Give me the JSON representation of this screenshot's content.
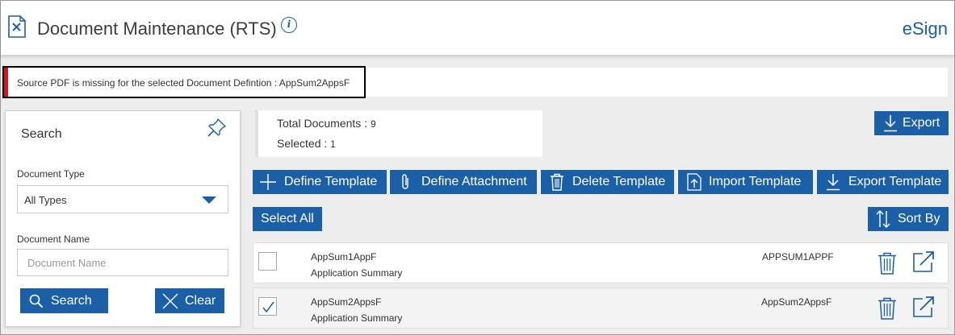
{
  "header": {
    "title": "Document Maintenance (RTS)",
    "brand": "eSign",
    "icons": {
      "doc": "document-tools-icon",
      "info": "info-icon"
    },
    "info_glyph": "i"
  },
  "alert": {
    "message": "Source PDF is missing for the selected Document Defintion : AppSum2AppsF",
    "color": "#d9121b"
  },
  "search": {
    "title": "Search",
    "document_type_label": "Document Type",
    "document_type_value": "All Types",
    "document_name_label": "Document Name",
    "document_name_placeholder": "Document Name",
    "search_button": "Search",
    "clear_button": "Clear"
  },
  "summary": {
    "total_label": "Total Documents : ",
    "total_value": "9",
    "selected_label": "Selected : ",
    "selected_value": "1"
  },
  "toolbar": {
    "export": "Export",
    "define_template": "Define Template",
    "define_attachment": "Define Attachment",
    "delete_template": "Delete Template",
    "import_template": "Import Template",
    "export_template": "Export Template",
    "select_all": "Select All",
    "sort_by": "Sort By"
  },
  "documents": [
    {
      "name": "AppSum1AppF",
      "description": "Application Summary",
      "code": "APPSUM1APPF",
      "checked": false
    },
    {
      "name": "AppSum2AppsF",
      "description": "Application Summary",
      "code": "AppSum2AppsF",
      "checked": true
    }
  ],
  "colors": {
    "primary": "#1b5fa6",
    "background": "#ededed"
  }
}
